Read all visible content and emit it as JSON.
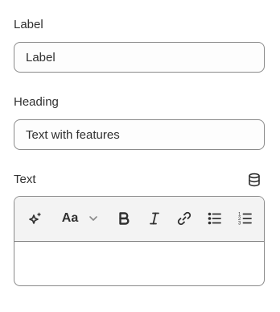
{
  "fields": {
    "label": {
      "label": "Label",
      "value": "Label"
    },
    "heading": {
      "label": "Heading",
      "value": "Text with features"
    },
    "text": {
      "label": "Text"
    }
  },
  "toolbar": {
    "items": [
      {
        "icon": "sparkle-icon"
      },
      {
        "icon": "font-size-icon",
        "text": "Aa"
      },
      {
        "icon": "chevron-down-icon"
      },
      {
        "icon": "bold-icon"
      },
      {
        "icon": "italic-icon"
      },
      {
        "icon": "link-icon"
      },
      {
        "icon": "bullet-list-icon"
      },
      {
        "icon": "numbered-list-icon"
      }
    ]
  },
  "icons": {
    "dynamic_source": "database-icon"
  }
}
